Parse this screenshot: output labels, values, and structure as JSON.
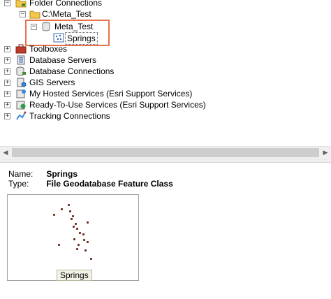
{
  "tree": {
    "items": [
      {
        "label": "Folder Connections",
        "icon": "folder-connections-icon"
      },
      {
        "label": "C:\\Meta_Test",
        "icon": "folder-icon"
      },
      {
        "label": "Meta_Test",
        "icon": "file-geodatabase-icon"
      },
      {
        "label": "Springs",
        "icon": "point-feature-class-icon"
      },
      {
        "label": "Toolboxes",
        "icon": "toolbox-icon"
      },
      {
        "label": "Database Servers",
        "icon": "database-server-icon"
      },
      {
        "label": "Database Connections",
        "icon": "database-connection-icon"
      },
      {
        "label": "GIS Servers",
        "icon": "gis-server-icon"
      },
      {
        "label": "My Hosted Services (Esri Support Services)",
        "icon": "hosted-services-icon"
      },
      {
        "label": "Ready-To-Use Services (Esri Support Services)",
        "icon": "ready-to-use-services-icon"
      },
      {
        "label": "Tracking Connections",
        "icon": "tracking-connections-icon"
      }
    ],
    "expander_collapsed": "+",
    "expander_expanded": "−"
  },
  "details": {
    "name_key": "Name:",
    "name_value": "Springs",
    "type_key": "Type:",
    "type_value": "File Geodatabase Feature Class",
    "thumbnail_caption": "Springs"
  },
  "colors": {
    "highlight_border": "#e8734a",
    "point_color": "#6b2a1d"
  }
}
